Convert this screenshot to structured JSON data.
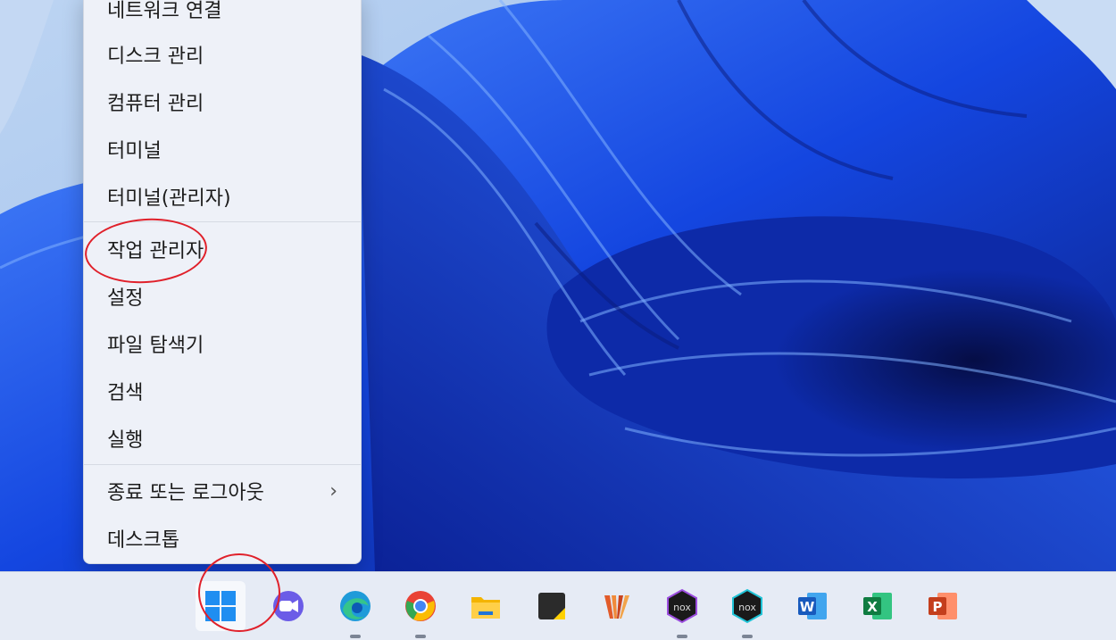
{
  "context_menu": {
    "items": [
      {
        "label": "네트워크 연결"
      },
      {
        "label": "디스크 관리"
      },
      {
        "label": "컴퓨터 관리"
      },
      {
        "label": "터미널"
      },
      {
        "label": "터미널(관리자)"
      },
      {
        "label": "작업 관리자"
      },
      {
        "label": "설정"
      },
      {
        "label": "파일 탐색기"
      },
      {
        "label": "검색"
      },
      {
        "label": "실행"
      },
      {
        "label": "종료 또는 로그아웃",
        "has_submenu": true,
        "submenu_glyph": "›"
      },
      {
        "label": "데스크톱"
      }
    ],
    "annotated_item": "작업 관리자"
  },
  "taskbar": {
    "items": [
      {
        "icon": "windows-start-icon",
        "active": true
      },
      {
        "icon": "teams-chat-icon"
      },
      {
        "icon": "edge-icon",
        "running": true
      },
      {
        "icon": "chrome-icon",
        "running": true
      },
      {
        "icon": "file-explorer-icon"
      },
      {
        "icon": "sticky-notes-icon"
      },
      {
        "icon": "vegas-pro-icon"
      },
      {
        "icon": "nox-player-icon",
        "running": true
      },
      {
        "icon": "nox-multi-icon",
        "running": true
      },
      {
        "icon": "word-icon",
        "letter": "W"
      },
      {
        "icon": "excel-icon",
        "letter": "X"
      },
      {
        "icon": "powerpoint-icon",
        "letter": "P"
      }
    ]
  },
  "colors": {
    "wallpaper_dark": "#0a1a7a",
    "wallpaper_mid": "#1446e0",
    "wallpaper_light": "#4f8dff",
    "annotation_red": "#e0202a"
  }
}
